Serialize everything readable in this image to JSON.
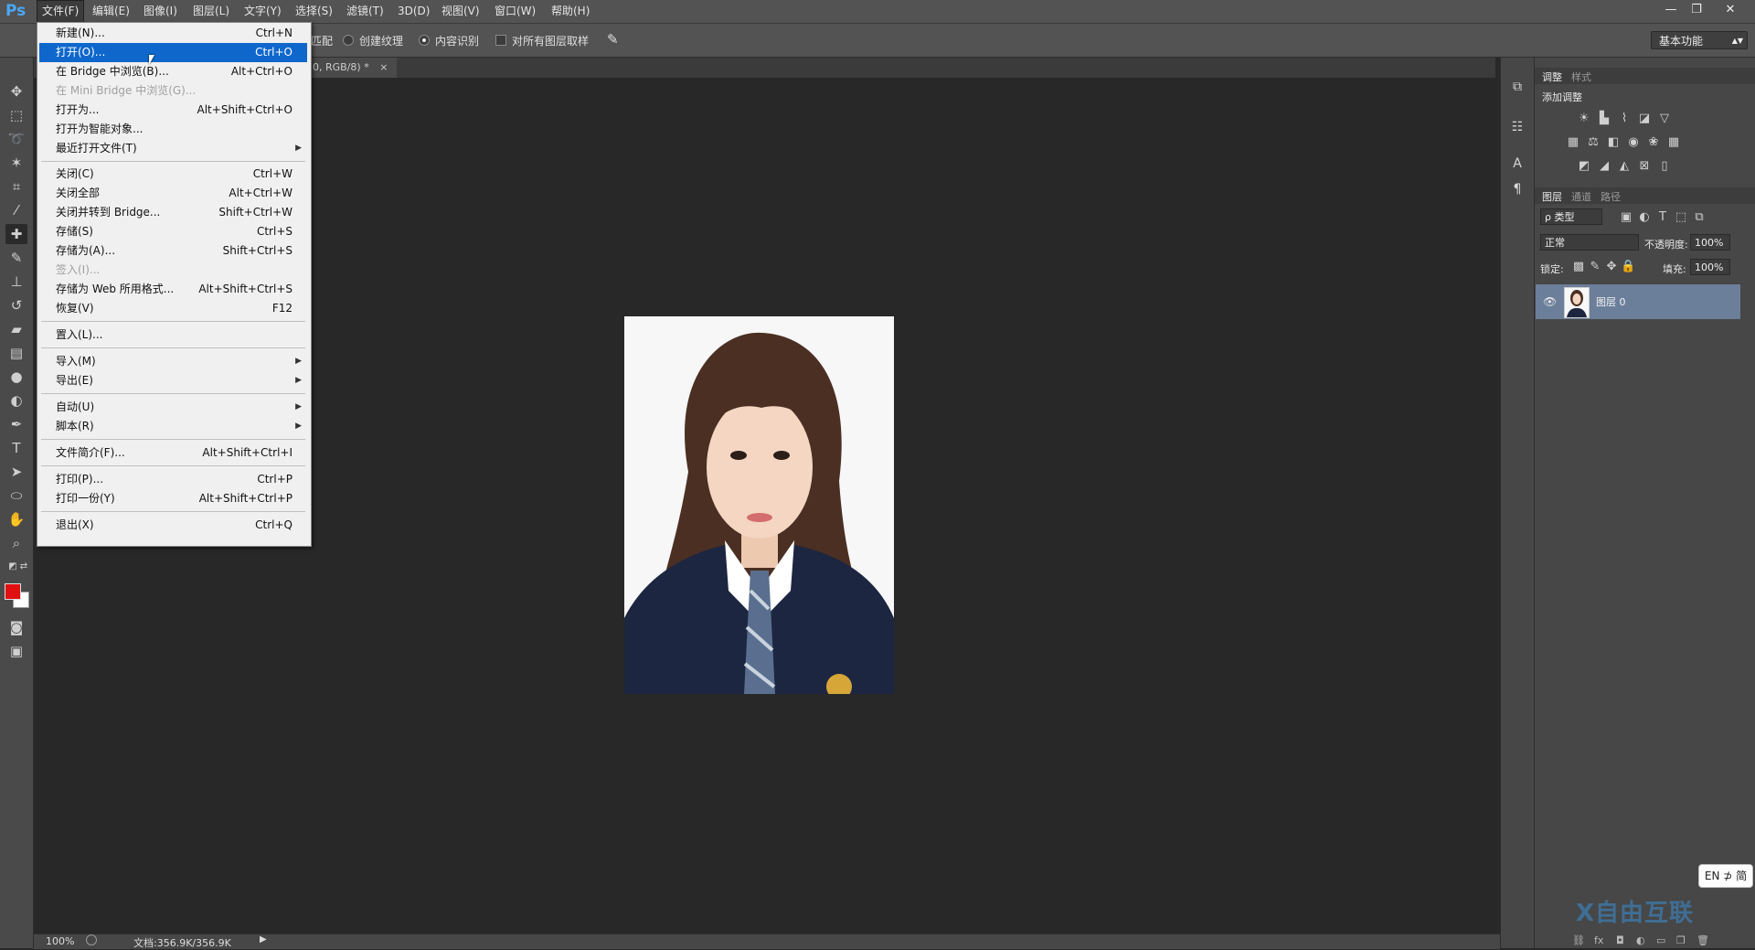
{
  "app": {
    "logo": "Ps"
  },
  "menubar": {
    "items": [
      "文件(F)",
      "编辑(E)",
      "图像(I)",
      "图层(L)",
      "文字(Y)",
      "选择(S)",
      "滤镜(T)",
      "3D(D)",
      "视图(V)",
      "窗口(W)",
      "帮助(H)"
    ],
    "window_buttons": [
      "—",
      "❐",
      "✕"
    ]
  },
  "options_bar": {
    "partial_label": "匹配",
    "create_texture": "创建纹理",
    "content_aware": "内容识别",
    "sample_all_layers": "对所有图层取样",
    "workspace": "基本功能"
  },
  "document": {
    "tab_label": "0, RGB/8) *",
    "tab_close": "×"
  },
  "file_menu": {
    "items": [
      {
        "label": "新建(N)...",
        "shortcut": "Ctrl+N"
      },
      {
        "label": "打开(O)...",
        "shortcut": "Ctrl+O"
      },
      {
        "label": "在 Bridge 中浏览(B)...",
        "shortcut": "Alt+Ctrl+O"
      },
      {
        "label": "在 Mini Bridge 中浏览(G)...",
        "shortcut": ""
      },
      {
        "label": "打开为...",
        "shortcut": "Alt+Shift+Ctrl+O"
      },
      {
        "label": "打开为智能对象...",
        "shortcut": ""
      },
      {
        "label": "最近打开文件(T)",
        "shortcut": ""
      },
      {
        "label": "关闭(C)",
        "shortcut": "Ctrl+W"
      },
      {
        "label": "关闭全部",
        "shortcut": "Alt+Ctrl+W"
      },
      {
        "label": "关闭并转到 Bridge...",
        "shortcut": "Shift+Ctrl+W"
      },
      {
        "label": "存储(S)",
        "shortcut": "Ctrl+S"
      },
      {
        "label": "存储为(A)...",
        "shortcut": "Shift+Ctrl+S"
      },
      {
        "label": "签入(I)...",
        "shortcut": ""
      },
      {
        "label": "存储为 Web 所用格式...",
        "shortcut": "Alt+Shift+Ctrl+S"
      },
      {
        "label": "恢复(V)",
        "shortcut": "F12"
      },
      {
        "label": "置入(L)...",
        "shortcut": ""
      },
      {
        "label": "导入(M)",
        "shortcut": ""
      },
      {
        "label": "导出(E)",
        "shortcut": ""
      },
      {
        "label": "自动(U)",
        "shortcut": ""
      },
      {
        "label": "脚本(R)",
        "shortcut": ""
      },
      {
        "label": "文件简介(F)...",
        "shortcut": "Alt+Shift+Ctrl+I"
      },
      {
        "label": "打印(P)...",
        "shortcut": "Ctrl+P"
      },
      {
        "label": "打印一份(Y)",
        "shortcut": "Alt+Shift+Ctrl+P"
      },
      {
        "label": "退出(X)",
        "shortcut": "Ctrl+Q"
      }
    ]
  },
  "status_bar": {
    "zoom": "100%",
    "doc_size": "文档:356.9K/356.9K"
  },
  "adjustments_panel": {
    "tabs": [
      "调整",
      "样式"
    ],
    "title": "添加调整"
  },
  "layers_panel": {
    "tabs": [
      "图层",
      "通道",
      "路径"
    ],
    "filter_kind": "ρ 类型",
    "blend_mode": "正常",
    "opacity_label": "不透明度:",
    "opacity_value": "100%",
    "lock_label": "锁定:",
    "fill_label": "填充:",
    "fill_value": "100%",
    "layer_name": "图层 0"
  },
  "ime": {
    "label": "EN ⊅ 简"
  },
  "watermark": {
    "text": "X自由互联"
  },
  "colors": {
    "foreground": "#e01010",
    "background": "#ffffff",
    "highlight": "#0f67cc"
  }
}
